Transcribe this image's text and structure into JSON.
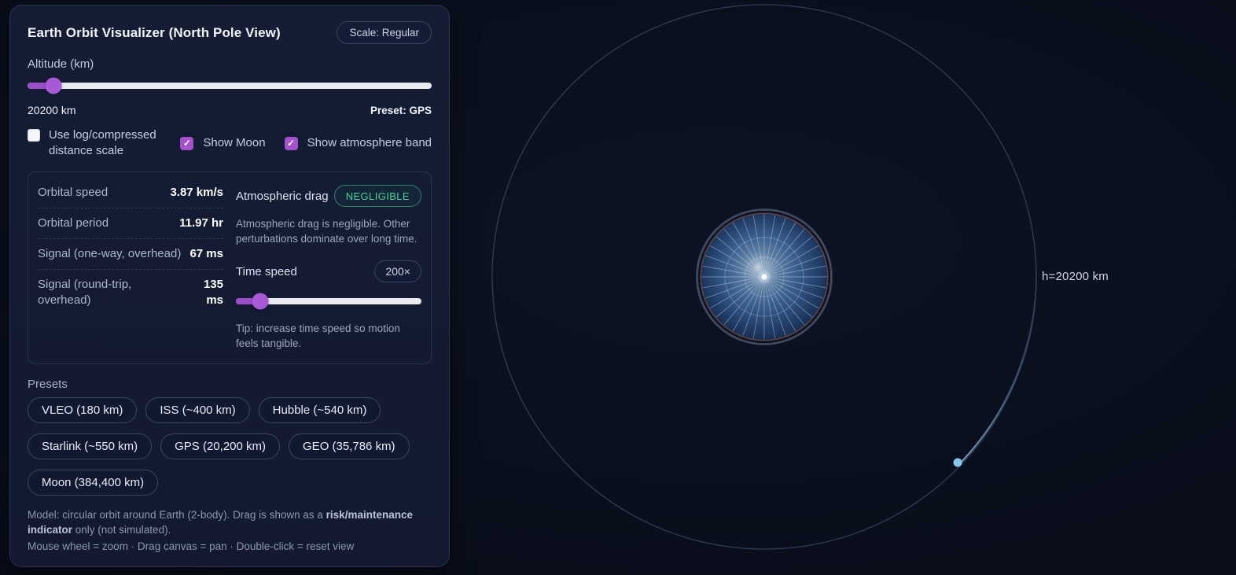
{
  "app": {
    "title": "Earth Orbit Visualizer (North Pole View)",
    "scale_badge": "Scale: Regular"
  },
  "altitude": {
    "label": "Altitude (km)",
    "value": "20200 km",
    "preset": "Preset: GPS",
    "slider_percent": 6.5
  },
  "toggles": {
    "log_scale": {
      "label": "Use log/compressed distance scale",
      "checked": false
    },
    "show_moon": {
      "label": "Show Moon",
      "checked": true
    },
    "show_atmosphere": {
      "label": "Show atmosphere band",
      "checked": true
    }
  },
  "stats": {
    "rows": [
      {
        "label": "Orbital speed",
        "value": "3.87 km/s"
      },
      {
        "label": "Orbital period",
        "value": "11.97 hr"
      },
      {
        "label": "Signal (one-way, overhead)",
        "value": "67 ms"
      },
      {
        "label": "Signal (round-trip, overhead)",
        "value": "135 ms"
      }
    ],
    "drag": {
      "label": "Atmospheric drag",
      "status": "NEGLIGIBLE",
      "description": "Atmospheric drag is negligible. Other perturbations dominate over long time."
    },
    "time_speed": {
      "label": "Time speed",
      "badge": "200×",
      "slider_percent": 13,
      "tip": "Tip: increase time speed so motion feels tangible."
    }
  },
  "presets": {
    "heading": "Presets",
    "buttons": [
      "VLEO (180 km)",
      "ISS (~400 km)",
      "Hubble (~540 km)",
      "Starlink (~550 km)",
      "GPS (20,200 km)",
      "GEO (35,786 km)",
      "Moon (384,400 km)"
    ]
  },
  "footer": {
    "model_prefix": "Model: circular orbit around Earth (2-body). Drag is shown as a ",
    "model_bold": "risk/maintenance indicator",
    "model_suffix": " only (not simulated).",
    "hints": "Mouse wheel = zoom · Drag canvas = pan · Double-click = reset view"
  },
  "scene": {
    "orbit_label": "h=20200 km"
  },
  "colors": {
    "accent_purple": "#a455d2",
    "status_green": "#3fd796",
    "satellite_blue": "#85c8ee",
    "track_light": "#e9ebf1"
  }
}
